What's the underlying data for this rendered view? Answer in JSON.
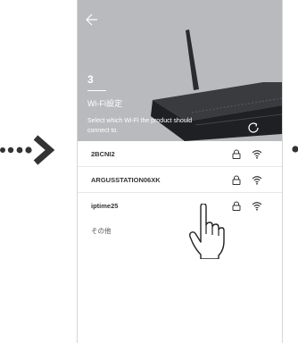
{
  "header": {
    "step_number": "3",
    "title": "Wi-Fi設定",
    "description": "Select which Wi-Fi the product should connect to."
  },
  "networks": [
    {
      "name": "2BCNI2",
      "secured": true
    },
    {
      "name": "ARGUSSTATION06XK",
      "secured": true
    },
    {
      "name": "iptime25",
      "secured": true
    }
  ],
  "other_label": "その他",
  "icons": {
    "back": "back-arrow-icon",
    "refresh": "refresh-icon",
    "lock": "lock-icon",
    "wifi": "wifi-icon",
    "pointer": "hand-pointer-icon"
  },
  "colors": {
    "header_bg": "#b9babd",
    "accent_arrow": "#333333"
  }
}
